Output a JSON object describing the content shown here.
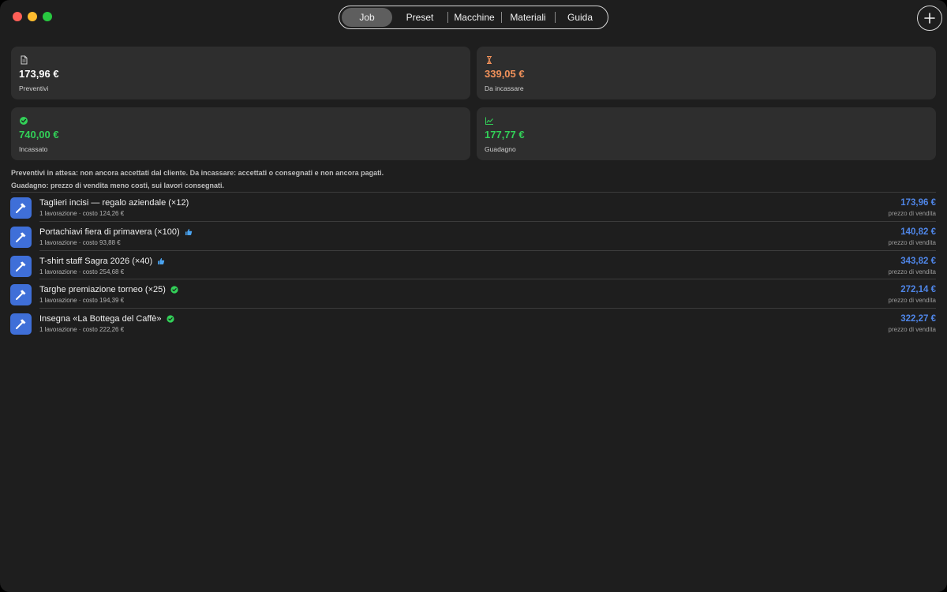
{
  "toolbar": {
    "tabs": [
      "Job",
      "Preset",
      "Macchine",
      "Materiali",
      "Guida"
    ],
    "active_tab": "Job"
  },
  "summary": {
    "preventivi": {
      "value": "173,96 €",
      "label": "Preventivi",
      "color": "#ffffff",
      "icon": "document-icon"
    },
    "da_incassare": {
      "value": "339,05 €",
      "label": "Da incassare",
      "color": "#f0915a",
      "icon": "hourglass-icon"
    },
    "incassato": {
      "value": "740,00 €",
      "label": "Incassato",
      "color": "#32d158",
      "icon": "checkmark-circle-icon"
    },
    "guadagno": {
      "value": "177,77 €",
      "label": "Guadagno",
      "color": "#32d158",
      "icon": "chart-line-icon"
    }
  },
  "notes": {
    "line1": "Preventivi in attesa: non ancora accettati dal cliente. Da incassare: accettati o consegnati e non ancora pagati.",
    "line2": "Guadagno: prezzo di vendita meno costi, sui lavori consegnati."
  },
  "jobs": [
    {
      "title": "Taglieri incisi — regalo aziendale (×12)",
      "subtitle": "1 lavorazione · costo 124,26 €",
      "price": "173,96 €",
      "price_label": "prezzo di vendita",
      "status": "none"
    },
    {
      "title": "Portachiavi fiera di primavera (×100)",
      "subtitle": "1 lavorazione · costo 93,88 €",
      "price": "140,82 €",
      "price_label": "prezzo di vendita",
      "status": "thumbs-up"
    },
    {
      "title": "T-shirt staff Sagra 2026 (×40)",
      "subtitle": "1 lavorazione · costo 254,68 €",
      "price": "343,82 €",
      "price_label": "prezzo di vendita",
      "status": "thumbs-up"
    },
    {
      "title": "Targhe premiazione torneo (×25)",
      "subtitle": "1 lavorazione · costo 194,39 €",
      "price": "272,14 €",
      "price_label": "prezzo di vendita",
      "status": "checkmark"
    },
    {
      "title": "Insegna «La Bottega del Caffè»",
      "subtitle": "1 lavorazione · costo 222,26 €",
      "price": "322,27 €",
      "price_label": "prezzo di vendita",
      "status": "checkmark"
    }
  ],
  "colors": {
    "accent": "#4f86e8",
    "job_icon_bg": "#3f6fd8",
    "thumbs_up": "#4aa3f0",
    "checkmark": "#32d158"
  }
}
